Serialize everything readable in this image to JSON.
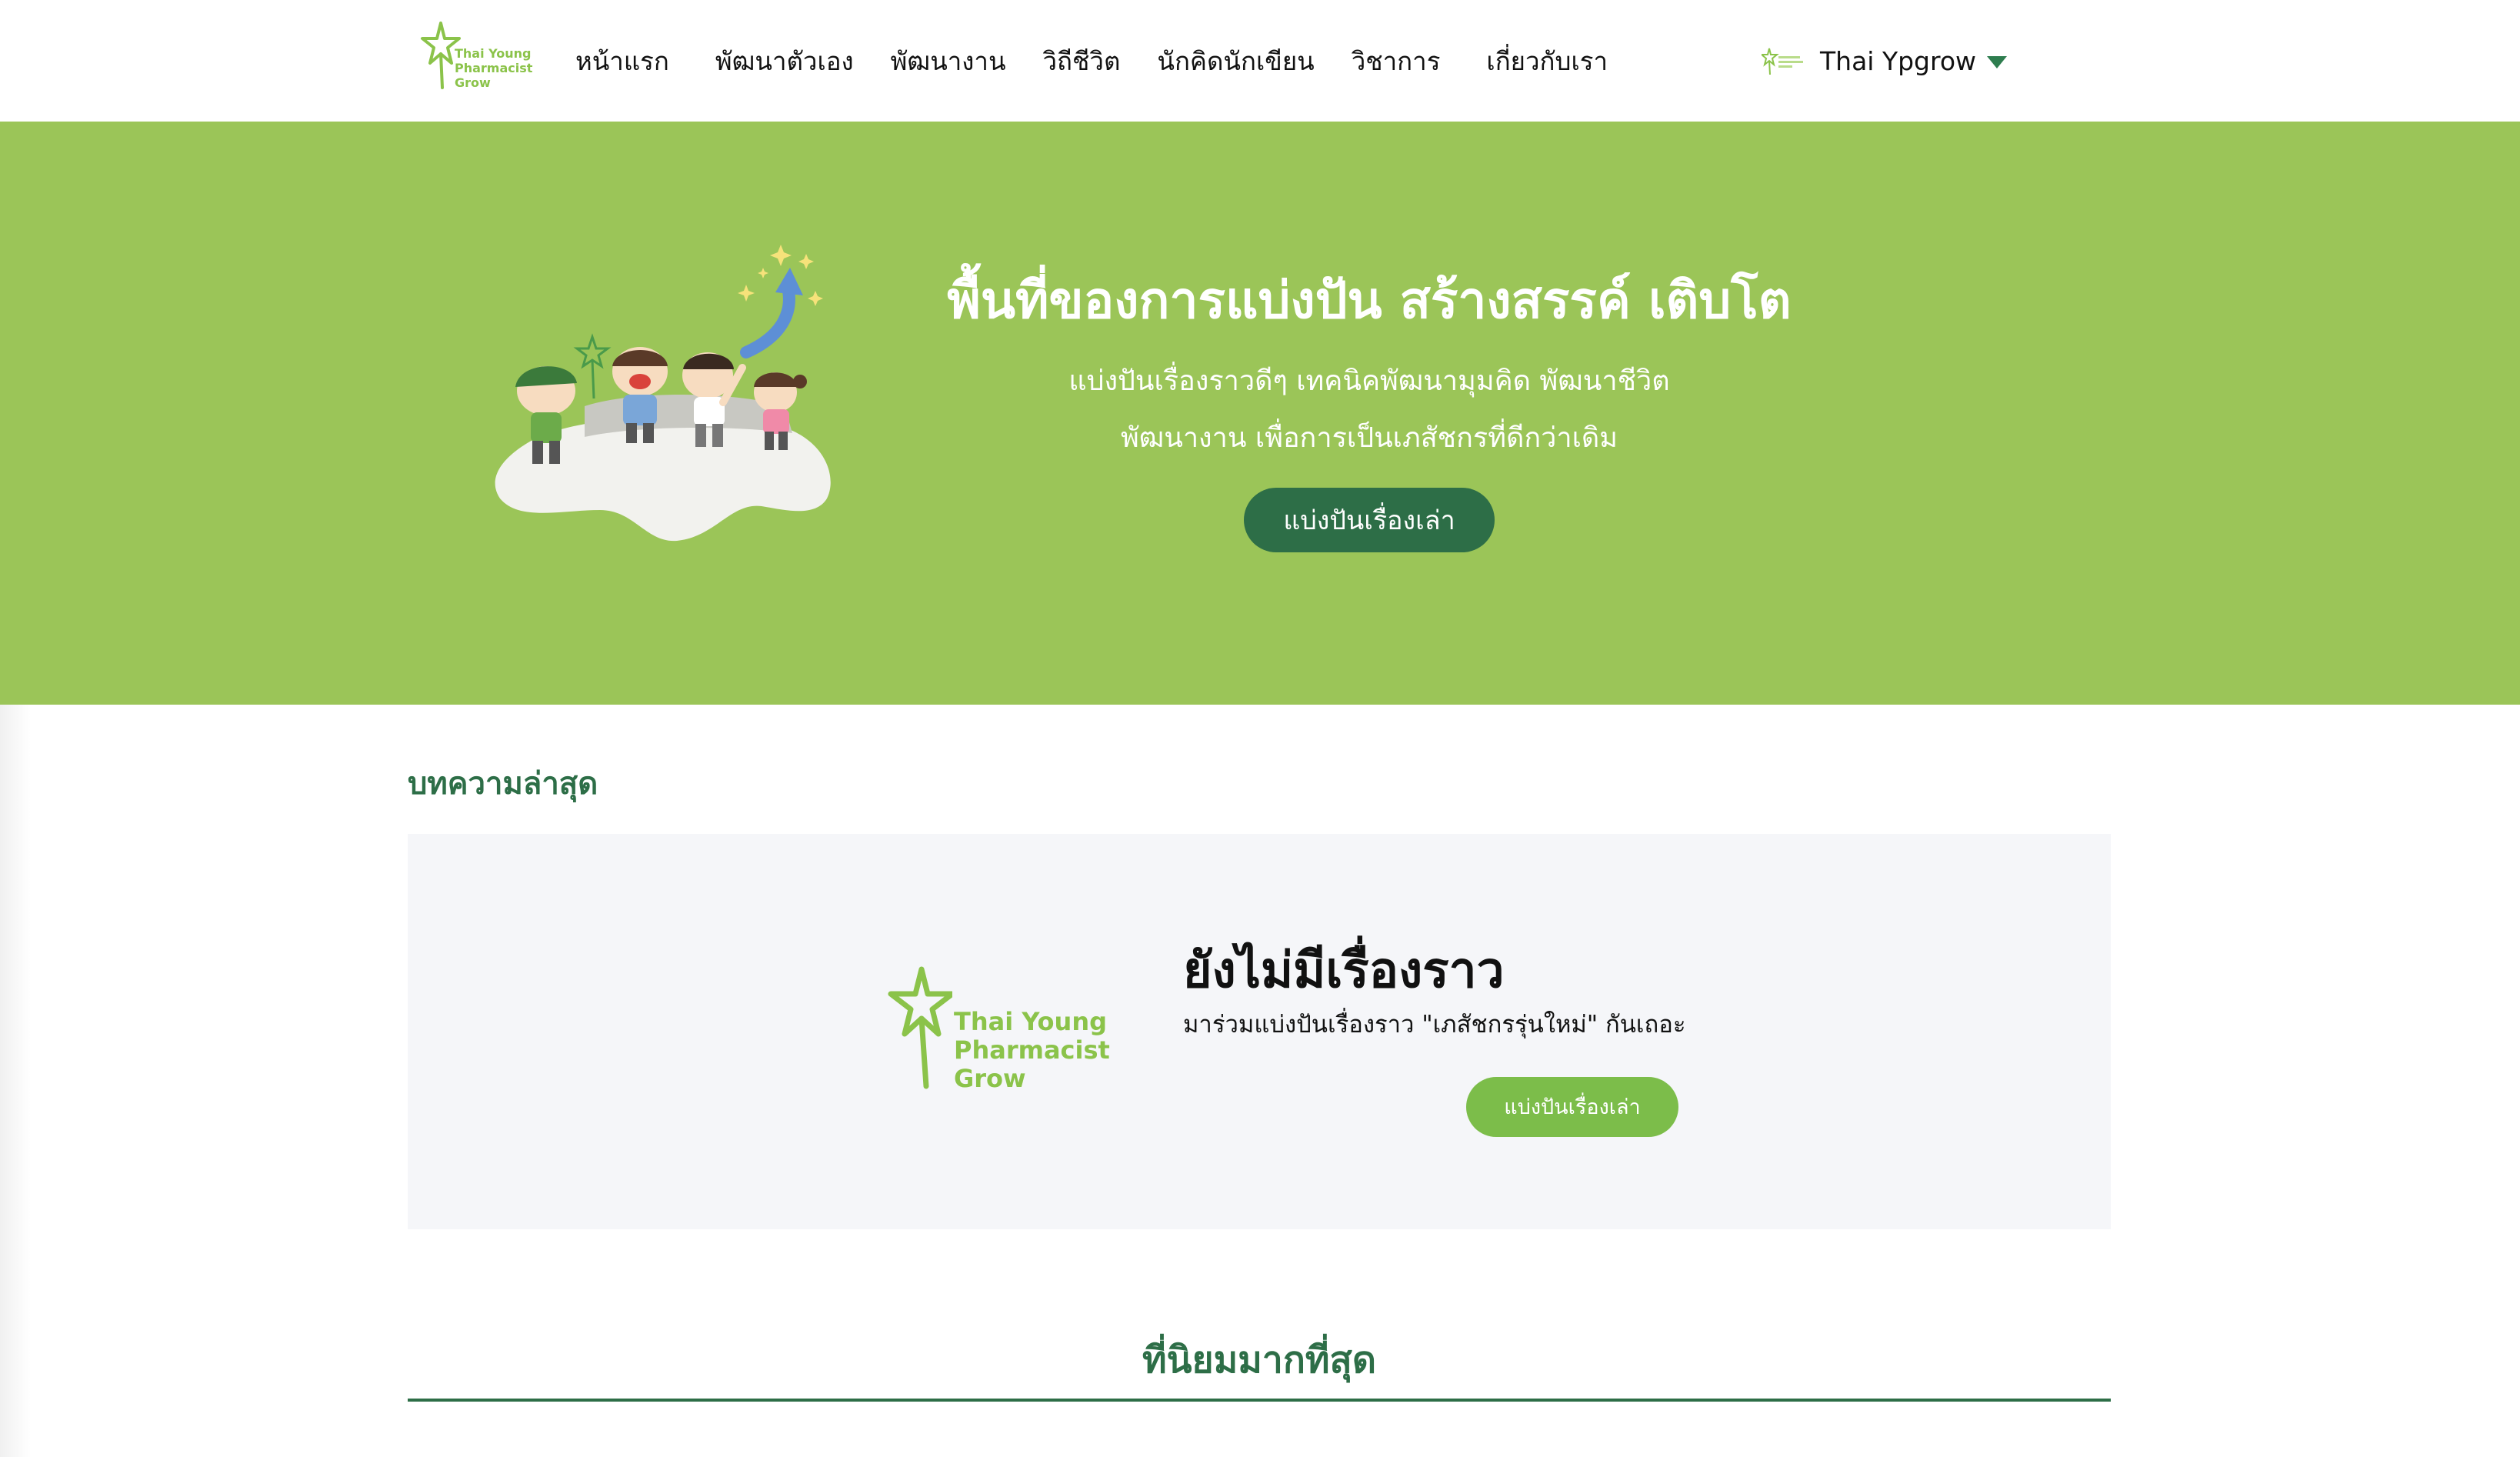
{
  "brand": {
    "logo_text_line1": "Thai Young",
    "logo_text_line2": "Pharmacist",
    "logo_text_line3": "Grow",
    "accent_green": "#9bc558",
    "dark_green": "#2d6e47",
    "light_green": "#7cbd4a"
  },
  "nav": {
    "items": [
      {
        "label": "หน้าแรก"
      },
      {
        "label": "พัฒนาตัวเอง"
      },
      {
        "label": "พัฒนางาน"
      },
      {
        "label": "วิถีชีวิต"
      },
      {
        "label": "นักคิดนักเขียน"
      },
      {
        "label": "วิชาการ"
      },
      {
        "label": "เกี่ยวกับเรา"
      }
    ],
    "user": {
      "name": "Thai Ypgrow",
      "avatar_icon": "logo-avatar-icon",
      "caret_icon": "caret-down-icon"
    }
  },
  "hero": {
    "title": "พื้นที่ของการแบ่งปัน สร้างสรรค์ เติบโต",
    "subtitle_line1": "แบ่งปันเรื่องราวดีๆ เทคนิคพัฒนามุมคิด พัฒนาชีวิต",
    "subtitle_line2": "พัฒนางาน เพื่อการเป็นเภสัชกรที่ดีกว่าเดิม",
    "cta_label": "แบ่งปันเรื่องเล่า"
  },
  "latest": {
    "heading": "บทความล่าสุด",
    "empty_title": "ยังไม่มีเรื่องราว",
    "empty_desc": "มาร่วมแบ่งปันเรื่องราว \"เภสัชกรรุ่นใหม่\" กันเถอะ",
    "empty_cta_label": "แบ่งปันเรื่องเล่า"
  },
  "popular": {
    "heading": "ที่นิยมมากที่สุด"
  }
}
